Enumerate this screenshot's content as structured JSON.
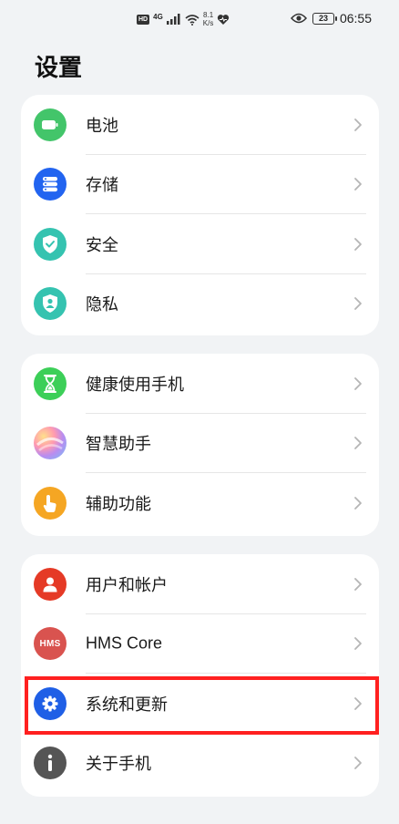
{
  "status_bar": {
    "hd": "HD",
    "network": "4G",
    "speed_value": "8.1",
    "speed_unit": "K/s",
    "battery": "23",
    "time": "06:55"
  },
  "page": {
    "title": "设置"
  },
  "groups": [
    {
      "items": [
        {
          "label": "电池",
          "icon": "battery-icon",
          "color": "#43c56a"
        },
        {
          "label": "存储",
          "icon": "storage-icon",
          "color": "#2264f0"
        },
        {
          "label": "安全",
          "icon": "shield-icon",
          "color": "#35c3b0"
        },
        {
          "label": "隐私",
          "icon": "privacy-icon",
          "color": "#35c3b0"
        }
      ]
    },
    {
      "items": [
        {
          "label": "健康使用手机",
          "icon": "hourglass-icon",
          "color": "#3ccf58"
        },
        {
          "label": "智慧助手",
          "icon": "assistant-orb-icon",
          "color": "#b98cf0"
        },
        {
          "label": "辅助功能",
          "icon": "hand-pointer-icon",
          "color": "#f5a623"
        }
      ]
    },
    {
      "items": [
        {
          "label": "用户和帐户",
          "icon": "user-icon",
          "color": "#e53a26"
        },
        {
          "label": "HMS Core",
          "icon": "hms-icon",
          "color": "#d9534f",
          "icon_text": "HMS"
        },
        {
          "label": "系统和更新",
          "icon": "gear-icon",
          "color": "#1f5fe6"
        },
        {
          "label": "关于手机",
          "icon": "info-icon",
          "color": "#555555"
        }
      ]
    }
  ]
}
